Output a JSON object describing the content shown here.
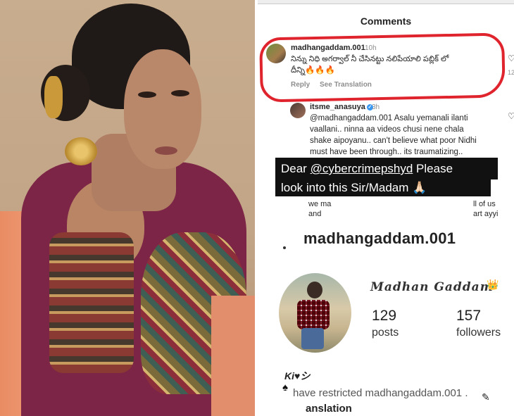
{
  "ig": {
    "title": "Comments",
    "comment1": {
      "username": "madhangaddam.001",
      "time": "10h",
      "text_line1": "నిన్ను నిధి అగర్వాల్ నీ చేసినట్టు నలిపేయాలి పబ్లిక్ లో",
      "text_line2": "దీన్ని🔥🔥🔥",
      "reply_label": "Reply",
      "translate_label": "See Translation"
    },
    "comment2": {
      "username": "itsme_anasuya",
      "time": "3h",
      "line1": "@madhangaddam.001 Asalu yemanali ilanti",
      "line2": "vaallani.. ninna aa videos chusi nene chala",
      "line3": "shake aipoyanu.. can't believe what poor Nidhi",
      "line4": "must have been through.. its traumatizing..",
      "partial_left": "we ma\nand",
      "partial_right": "ll of us\nart ayyi"
    },
    "like_count": "12",
    "sticker": {
      "prefix": "Dear ",
      "handle": "@cybercrimepshyd",
      "suffix": " Please",
      "line2": "look into this Sir/Madam 🙏🏻"
    },
    "profile": {
      "username": "madhangaddam.001",
      "display_name": "Madhan Gaddam",
      "crown": "👑",
      "posts_count": "129",
      "posts_label": "posts",
      "followers_count": "157",
      "followers_label": "followers"
    },
    "footer": {
      "kiss_text": "Ki♥シ",
      "restricted_text": "have restricted madhangaddam.001 .",
      "translation_text": "anslation"
    }
  }
}
